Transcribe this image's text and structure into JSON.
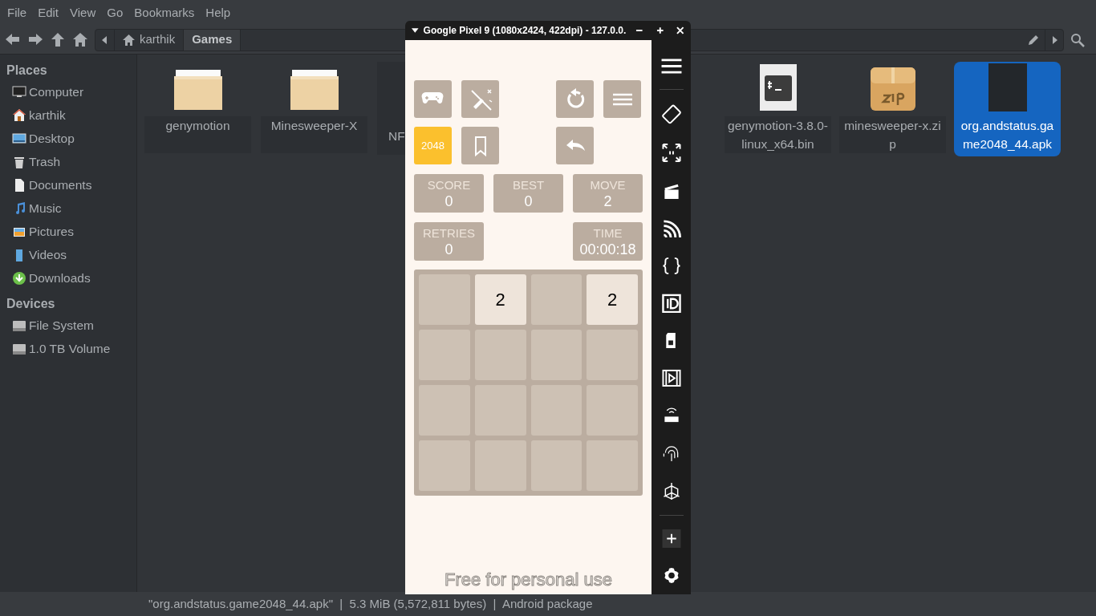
{
  "menu": [
    "File",
    "Edit",
    "View",
    "Go",
    "Bookmarks",
    "Help"
  ],
  "breadcrumb": [
    {
      "label": "karthik",
      "selected": false
    },
    {
      "label": "Games",
      "selected": true
    }
  ],
  "sidebar": [
    {
      "title": "Places",
      "items": [
        {
          "label": "Computer",
          "kind": "computer"
        },
        {
          "label": "karthik",
          "kind": "home"
        },
        {
          "label": "Desktop",
          "kind": "desktop"
        },
        {
          "label": "Trash",
          "kind": "trash"
        },
        {
          "label": "Documents",
          "kind": "document"
        },
        {
          "label": "Music",
          "kind": "music"
        },
        {
          "label": "Pictures",
          "kind": "pictures"
        },
        {
          "label": "Videos",
          "kind": "videos"
        },
        {
          "label": "Downloads",
          "kind": "downloads"
        }
      ]
    },
    {
      "title": "Devices",
      "items": [
        {
          "label": "File System",
          "kind": "drive"
        },
        {
          "label": "1.0 TB Volume",
          "kind": "drive"
        }
      ]
    }
  ],
  "files_left": [
    {
      "name": "genymotion",
      "kind": "folder",
      "selected": false
    },
    {
      "name": "Minesweeper-X",
      "kind": "folder",
      "selected": false
    },
    {
      "name": "NF",
      "kind": "cut",
      "selected": false
    }
  ],
  "files_right": [
    {
      "name": "genymotion-3.8.0-linux_x64.bin",
      "kind": "script",
      "selected": false
    },
    {
      "name": "minesweeper-x.zip",
      "kind": "zip",
      "selected": false
    },
    {
      "name": "org.andstatus.game2048_44.apk",
      "kind": "apk",
      "selected": true
    }
  ],
  "status_bar": "\"org.andstatus.game2048_44.apk\"  |  5.3 MiB (5,572,811 bytes)  |  Android package",
  "emulator": {
    "title": "Google Pixel 9 (1080x2424, 422dpi) - 127.0.0.",
    "button_rows": [
      [
        {
          "kind": "gamepad",
          "highlighted": false
        },
        {
          "kind": "tools",
          "highlighted": false
        },
        null,
        {
          "kind": "restart",
          "highlighted": false
        },
        {
          "kind": "menu",
          "highlighted": false
        }
      ],
      [
        {
          "kind": "text",
          "label": "2048",
          "highlighted": true
        },
        {
          "kind": "bookmark",
          "highlighted": false
        },
        null,
        {
          "kind": "undo",
          "highlighted": false
        },
        null
      ]
    ],
    "stat_rows": [
      [
        {
          "label": "SCORE",
          "value": "0"
        },
        {
          "label": "BEST",
          "value": "0"
        },
        {
          "label": "MOVE",
          "value": "2"
        }
      ],
      [
        {
          "label": "RETRIES",
          "value": "0"
        },
        null,
        {
          "label": "TIME",
          "value": "00:00:18"
        }
      ]
    ],
    "board": [
      [
        {
          "kind": "empty"
        },
        {
          "kind": "number",
          "value": "2"
        },
        {
          "kind": "empty"
        },
        {
          "kind": "number",
          "value": "2"
        }
      ],
      [
        {
          "kind": "empty"
        },
        {
          "kind": "empty"
        },
        {
          "kind": "empty"
        },
        {
          "kind": "empty"
        }
      ],
      [
        {
          "kind": "empty"
        },
        {
          "kind": "empty"
        },
        {
          "kind": "empty"
        },
        {
          "kind": "empty"
        }
      ],
      [
        {
          "kind": "empty"
        },
        {
          "kind": "empty"
        },
        {
          "kind": "empty"
        },
        {
          "kind": "empty"
        }
      ]
    ],
    "notice": "Free for personal use"
  }
}
